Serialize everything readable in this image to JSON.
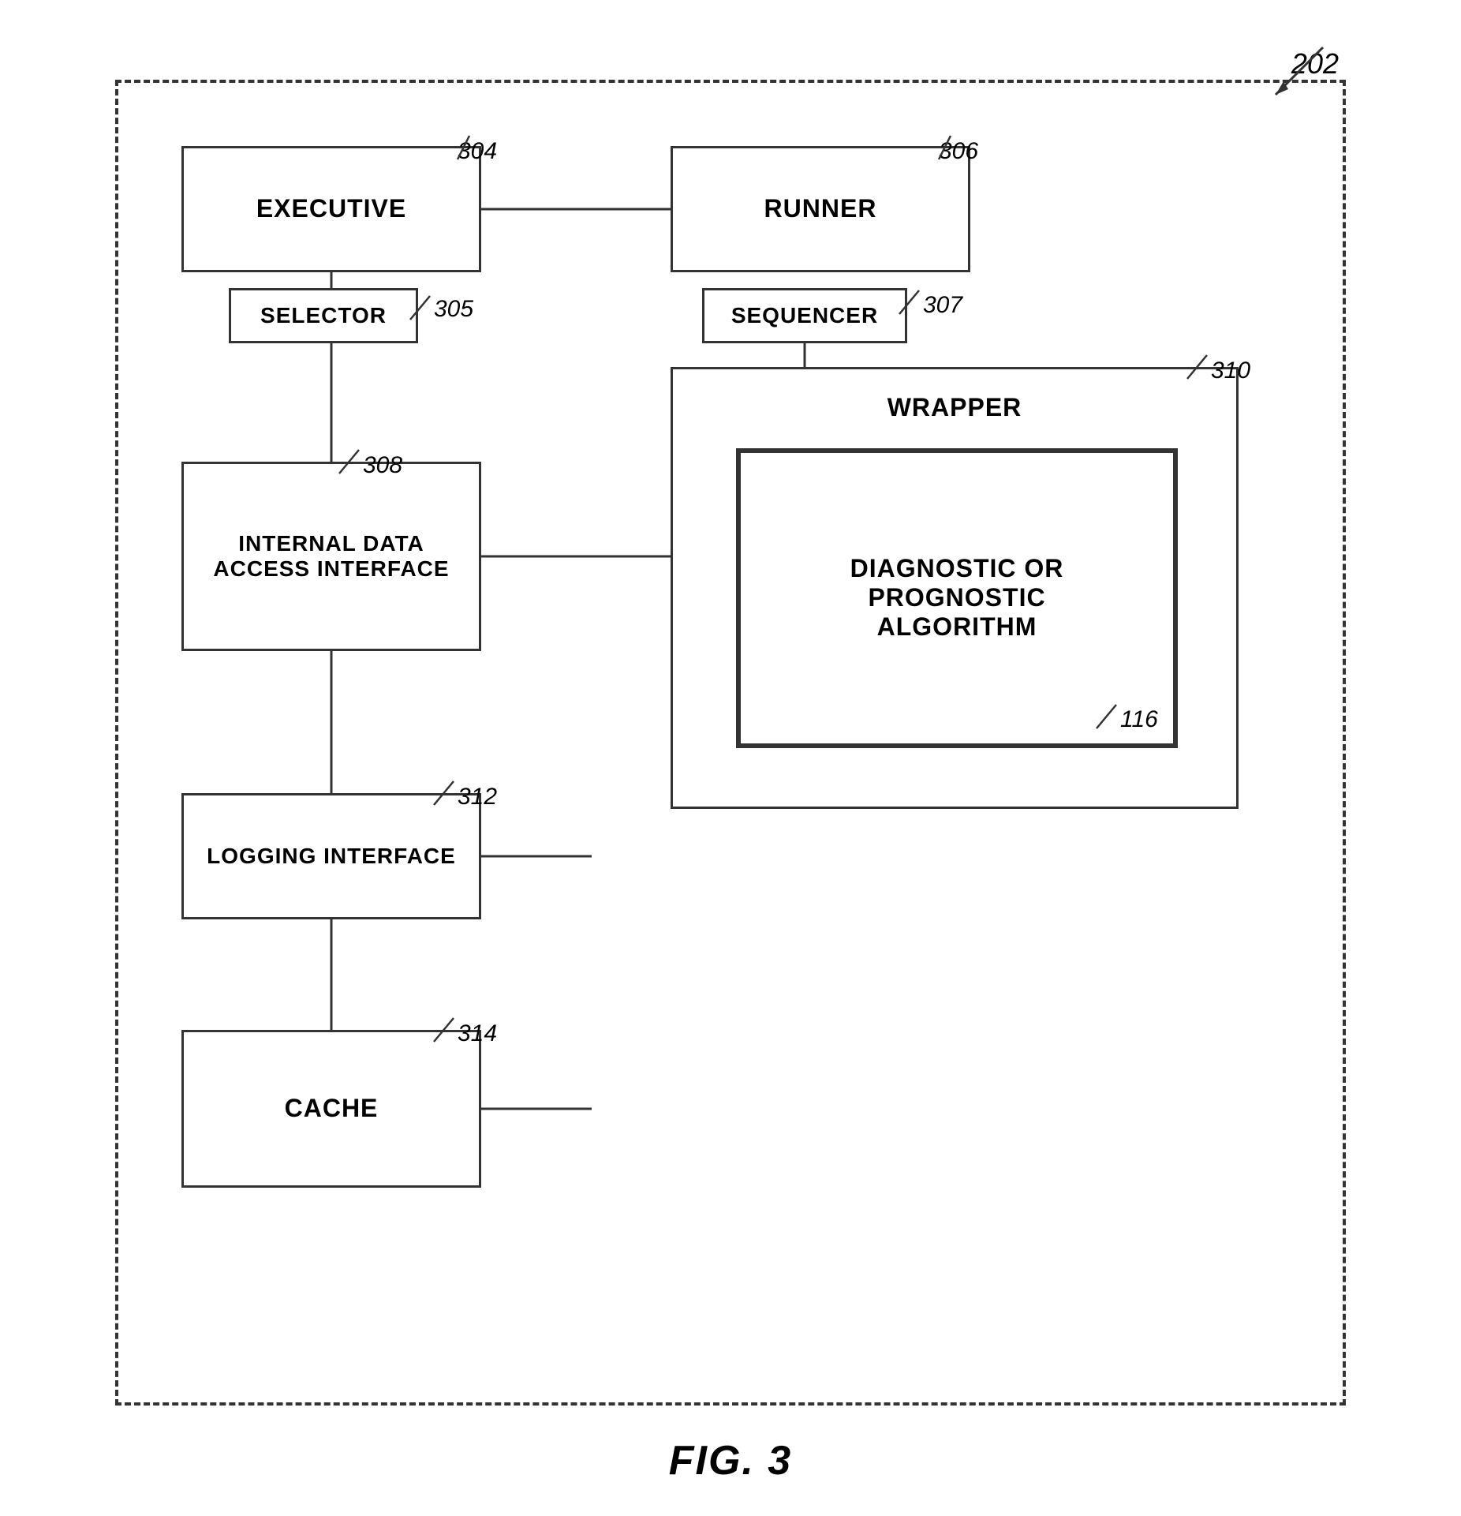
{
  "figure": {
    "ref_main": "202",
    "caption": "FIG. 3",
    "arrow_label": "202"
  },
  "boxes": {
    "executive": {
      "label": "EXECUTIVE",
      "ref": "304"
    },
    "runner": {
      "label": "RUNNER",
      "ref": "306"
    },
    "selector": {
      "label": "SELECTOR",
      "ref": "305"
    },
    "sequencer": {
      "label": "SEQUENCER",
      "ref": "307"
    },
    "wrapper": {
      "label": "WRAPPER",
      "ref": "310"
    },
    "dpai": {
      "label": "DIAGNOSTIC OR\nPROGNOSTIC\nALGORITHM",
      "ref": "116"
    },
    "idai": {
      "label": "INTERNAL DATA\nACCESS INTERFACE",
      "ref": "308"
    },
    "logging": {
      "label": "LOGGING INTERFACE",
      "ref": "312"
    },
    "cache": {
      "label": "CACHE",
      "ref": "314"
    }
  }
}
